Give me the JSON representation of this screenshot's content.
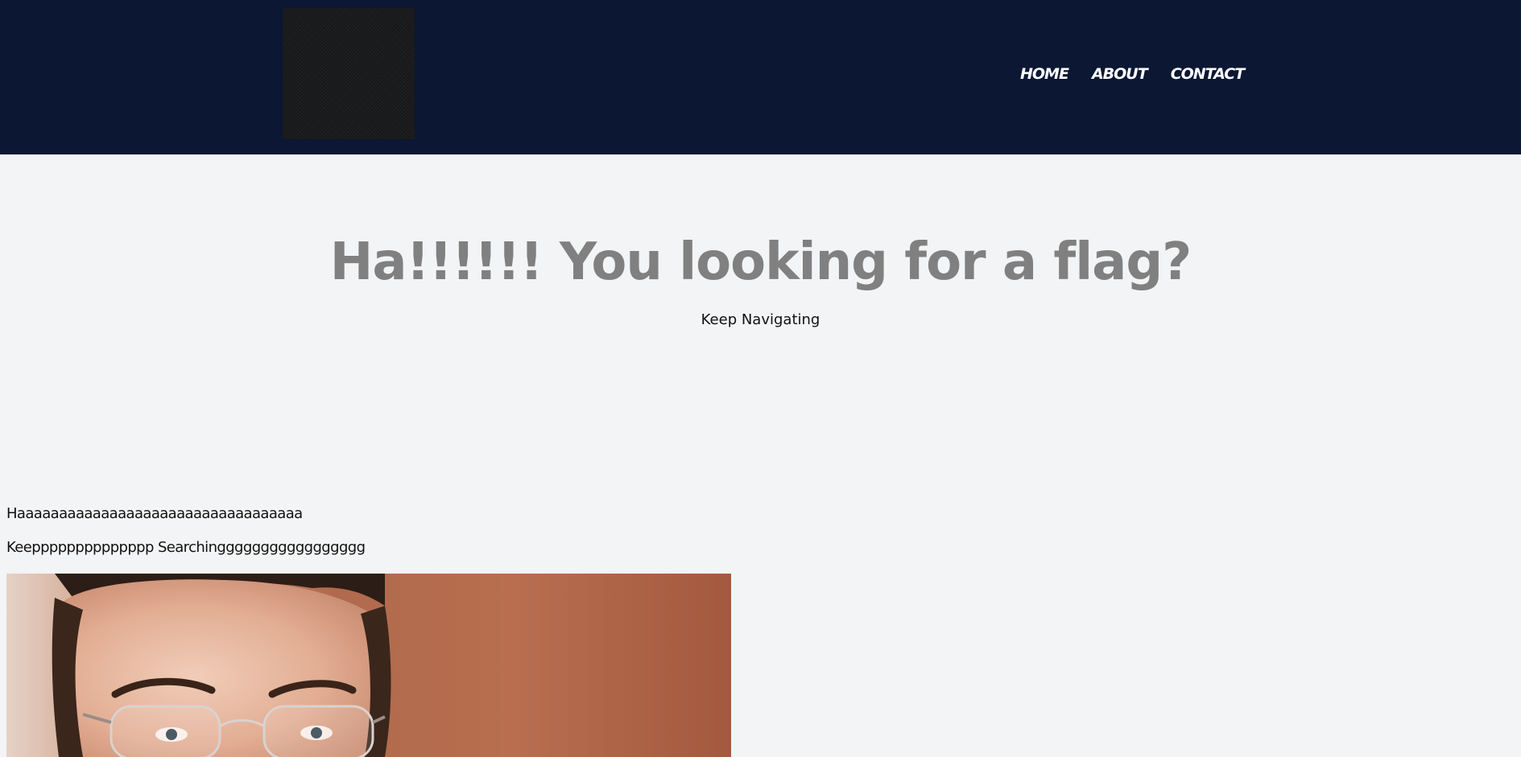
{
  "header": {
    "nav": [
      "HOME",
      "ABOUT",
      "CONTACT"
    ],
    "logo_alt": "site-logo"
  },
  "hero": {
    "title": "Ha!!!!!! You looking for a flag?",
    "subtitle": "Keep Navigating"
  },
  "content": {
    "line1": "Haaaaaaaaaaaaaaaaaaaaaaaaaaaaaaaaaa",
    "line2": "Keepppppppppppppp Searchinggggggggggggggggg"
  },
  "colors": {
    "header_bg": "#0b1733",
    "page_bg": "#f3f4f5",
    "title_color": "#808080"
  }
}
